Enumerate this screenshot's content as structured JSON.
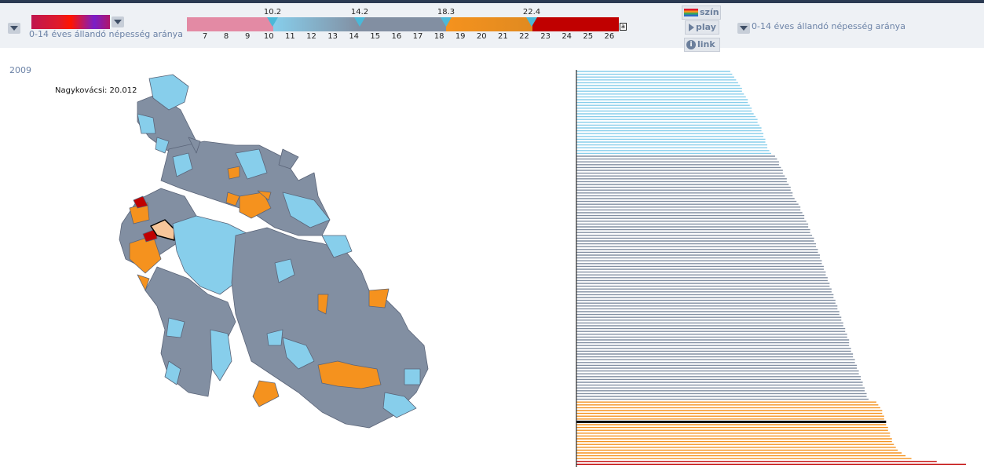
{
  "toolbar": {
    "indicator_left": "0-14 éves állandó népesség aránya",
    "indicator_right": "0-14 éves állandó népesség aránya",
    "szin_label": "szín",
    "play_label": "play",
    "link_label": "link",
    "ticks": [
      "7",
      "8",
      "9",
      "10",
      "11",
      "12",
      "13",
      "14",
      "15",
      "16",
      "17",
      "18",
      "19",
      "20",
      "21",
      "22",
      "23",
      "24",
      "25",
      "26"
    ],
    "thresholds": [
      "10.2",
      "14.2",
      "18.3",
      "22.4"
    ],
    "small_box": "a"
  },
  "year": "2009",
  "tooltip": "Nagykovácsi: 20.012",
  "colors": {
    "pink": "#e38aa4",
    "light_blue": "#87ceeb",
    "slate": "#828fa2",
    "orange": "#f5921e",
    "red": "#c00000",
    "highlight": "#f7c69a"
  },
  "bars": {
    "scale_min": 7,
    "scale_max": 27,
    "groups": [
      {
        "color": "light_blue",
        "values": [
          14.9,
          15.0,
          15.1,
          15.2,
          15.3,
          15.4,
          15.5,
          15.5,
          15.6,
          15.7,
          15.8,
          15.8,
          15.9,
          16.0,
          16.0,
          16.1,
          16.2,
          16.3,
          16.3,
          16.4,
          16.5,
          16.5,
          16.6,
          16.6,
          16.7,
          16.7,
          16.8,
          16.8,
          16.9,
          17.0
        ]
      },
      {
        "color": "slate",
        "values": [
          17.2,
          17.3,
          17.4,
          17.4,
          17.5,
          17.6,
          17.6,
          17.7,
          17.8,
          17.8,
          17.9,
          18.0,
          18.0,
          18.1,
          18.1,
          18.2,
          18.3,
          18.4,
          18.5,
          18.5,
          18.6,
          18.7,
          18.7,
          18.8,
          18.9,
          18.9,
          19.0,
          19.0,
          19.1,
          19.2,
          19.2,
          19.3,
          19.3,
          19.4,
          19.4,
          19.5,
          19.5,
          19.6,
          19.6,
          19.7,
          19.7,
          19.8,
          19.8,
          19.9,
          19.9,
          20.0,
          20.0,
          20.1,
          20.1,
          20.2,
          20.2,
          20.3,
          20.3,
          20.4,
          20.4,
          20.5,
          20.5,
          20.6,
          20.6,
          20.7,
          20.7,
          20.8,
          20.8,
          20.9,
          20.9,
          21.0,
          21.0,
          21.0,
          21.1,
          21.1,
          21.2,
          21.2,
          21.3,
          21.3,
          21.4,
          21.4,
          21.5,
          21.5,
          21.6,
          21.6,
          21.7,
          21.7,
          21.8,
          21.8,
          21.9,
          21.9,
          22.0
        ]
      },
      {
        "color": "orange",
        "values": [
          22.4,
          22.5,
          22.6,
          22.7,
          22.7,
          22.8,
          22.8,
          22.9,
          22.9,
          23.0,
          23.0,
          23.1,
          23.1,
          23.2,
          23.2,
          23.3,
          23.4,
          23.5,
          23.7,
          23.9,
          24.2
        ]
      },
      {
        "color": "red",
        "values": [
          25.5,
          27.0
        ]
      }
    ],
    "highlight_index": 124,
    "highlight_value": 20.012
  }
}
